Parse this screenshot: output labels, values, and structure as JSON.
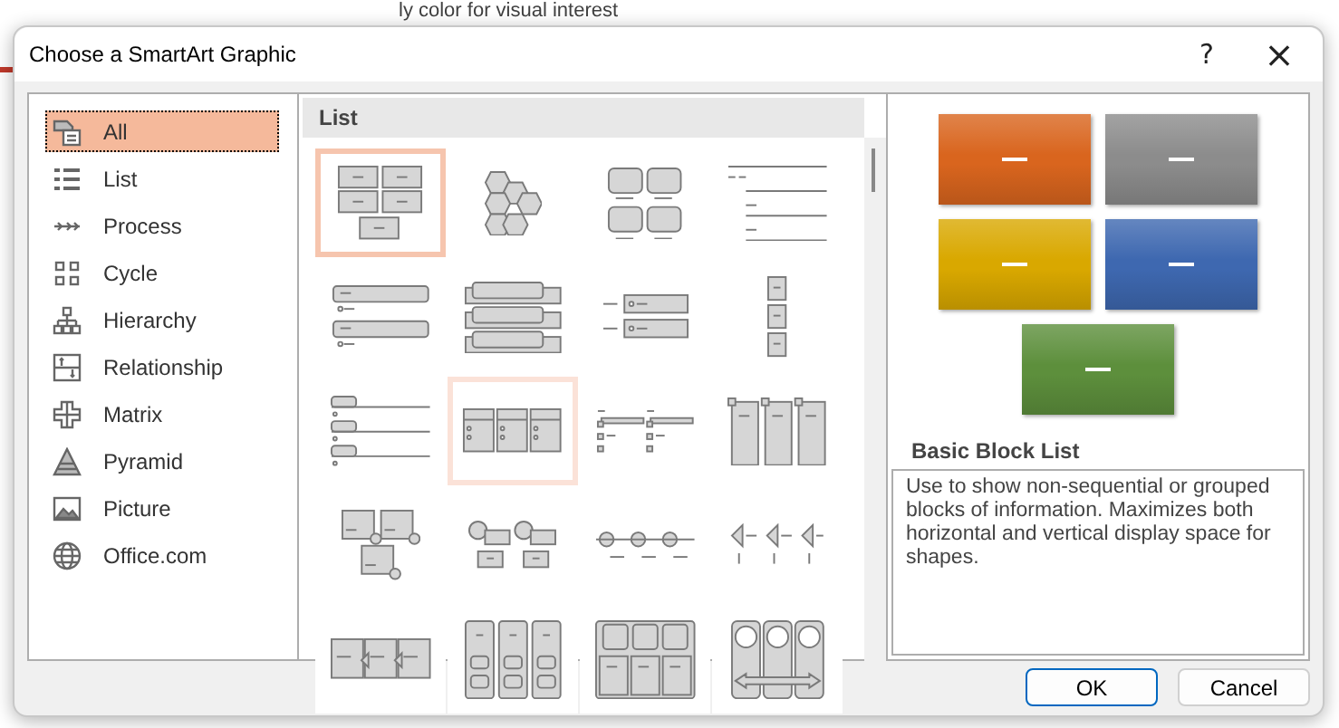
{
  "background": {
    "slide_title": "ly color for visual interest"
  },
  "window": {
    "title": "Choose a SmartArt Graphic",
    "help": "?",
    "close": "×"
  },
  "categories": [
    {
      "label": "All",
      "selected": true
    },
    {
      "label": "List",
      "selected": false
    },
    {
      "label": "Process",
      "selected": false
    },
    {
      "label": "Cycle",
      "selected": false
    },
    {
      "label": "Hierarchy",
      "selected": false
    },
    {
      "label": "Relationship",
      "selected": false
    },
    {
      "label": "Matrix",
      "selected": false
    },
    {
      "label": "Pyramid",
      "selected": false
    },
    {
      "label": "Picture",
      "selected": false
    },
    {
      "label": "Office.com",
      "selected": false
    }
  ],
  "gallery": {
    "heading": "List",
    "layouts": [
      {
        "kind": "block-grid",
        "selected": true,
        "hovered": false
      },
      {
        "kind": "hexagons",
        "selected": false,
        "hovered": false
      },
      {
        "kind": "rounded-blocks",
        "selected": false,
        "hovered": false
      },
      {
        "kind": "line-list",
        "selected": false,
        "hovered": false
      },
      {
        "kind": "bar-list",
        "selected": false,
        "hovered": false
      },
      {
        "kind": "offset-bars",
        "selected": false,
        "hovered": false
      },
      {
        "kind": "bracket-list",
        "selected": false,
        "hovered": false
      },
      {
        "kind": "vertical-stack",
        "selected": false,
        "hovered": false
      },
      {
        "kind": "tab-list",
        "selected": false,
        "hovered": false
      },
      {
        "kind": "column-cards",
        "selected": false,
        "hovered": true
      },
      {
        "kind": "bullet-lines",
        "selected": false,
        "hovered": false
      },
      {
        "kind": "tall-columns",
        "selected": false,
        "hovered": false
      },
      {
        "kind": "picture-captions",
        "selected": false,
        "hovered": false
      },
      {
        "kind": "circle-captions",
        "selected": false,
        "hovered": false
      },
      {
        "kind": "circle-line",
        "selected": false,
        "hovered": false
      },
      {
        "kind": "half-circles",
        "selected": false,
        "hovered": false
      },
      {
        "kind": "chevron-blocks",
        "selected": false,
        "hovered": false
      },
      {
        "kind": "column-stack",
        "selected": false,
        "hovered": false
      },
      {
        "kind": "table-blocks",
        "selected": false,
        "hovered": false
      },
      {
        "kind": "circle-columns",
        "selected": false,
        "hovered": false
      }
    ]
  },
  "preview": {
    "blocks": [
      {
        "color": "#d9651e"
      },
      {
        "color": "#8c8c8c"
      },
      {
        "color": "#d9a800"
      },
      {
        "color": "#3e68b0"
      },
      {
        "color": "#5d8f3c"
      }
    ],
    "title": "Basic Block List",
    "description": "Use to show non-sequential or grouped blocks of information. Maximizes both horizontal and vertical display space for shapes."
  },
  "buttons": [
    {
      "label": "OK",
      "default": true
    },
    {
      "label": "Cancel",
      "default": false
    }
  ]
}
